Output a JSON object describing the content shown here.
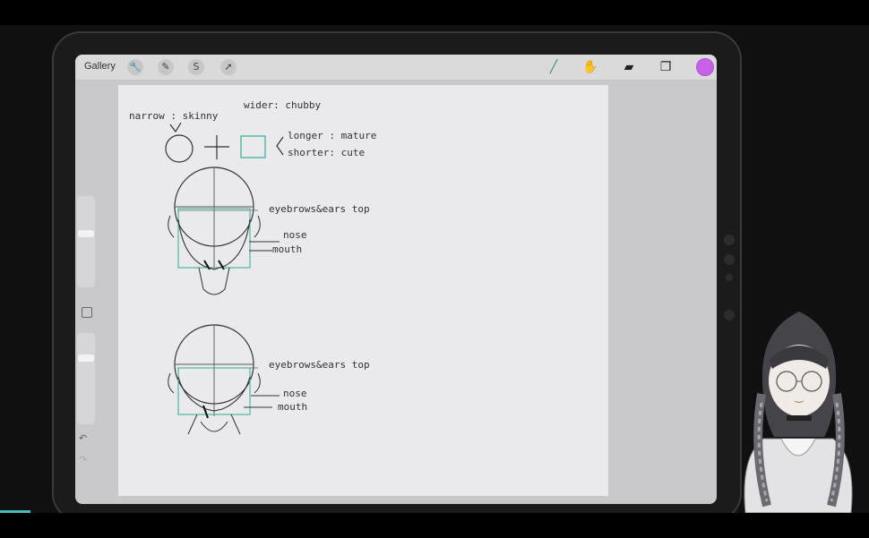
{
  "app": {
    "gallery_label": "Gallery",
    "accent_color": "#c860e8",
    "guide_color": "#4db6a4"
  },
  "toolbar_left": [
    {
      "name": "actions-wrench-icon",
      "glyph": "🔧"
    },
    {
      "name": "adjustments-wand-icon",
      "glyph": "✎"
    },
    {
      "name": "selection-s-icon",
      "glyph": "S"
    },
    {
      "name": "transform-arrow-icon",
      "glyph": "➚"
    }
  ],
  "toolbar_right": [
    {
      "name": "brush-icon",
      "glyph": "╱"
    },
    {
      "name": "smudge-icon",
      "glyph": "✋"
    },
    {
      "name": "eraser-icon",
      "glyph": "▰"
    },
    {
      "name": "layers-icon",
      "glyph": "❐"
    }
  ],
  "sidebar": {
    "undo_glyph": "↶",
    "redo_glyph": "↷"
  },
  "drawing": {
    "line1_left": "narrow : skinny",
    "line1_right": "wider: chubby",
    "longer_label": "longer : mature",
    "shorter_label": "shorter: cute",
    "head1": {
      "brows_label": "eyebrows&ears top",
      "nose_label": "nose",
      "mouth_label": "mouth"
    },
    "head2": {
      "brows_label": "eyebrows&ears top",
      "nose_label": "nose",
      "mouth_label": "mouth"
    }
  }
}
